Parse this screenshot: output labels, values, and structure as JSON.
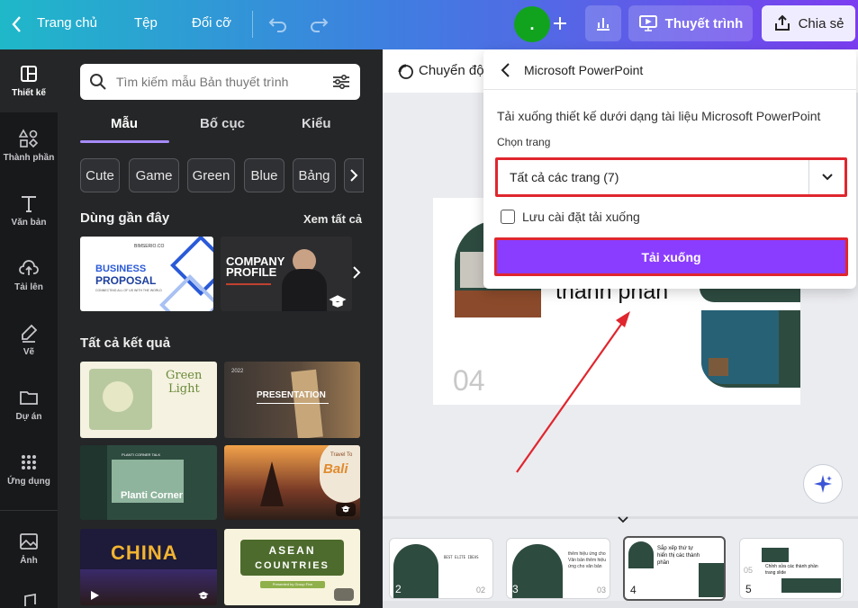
{
  "topbar": {
    "home_label": "Trang chủ",
    "file_label": "Tệp",
    "resize_label": "Đổi cỡ",
    "avatar_initial": ".",
    "present_label": "Thuyết trình",
    "share_label": "Chia sẻ"
  },
  "rail": {
    "items": [
      {
        "label": "Thiết kế",
        "icon": "layout-icon"
      },
      {
        "label": "Thành phần",
        "icon": "shapes-icon"
      },
      {
        "label": "Văn bản",
        "icon": "text-icon"
      },
      {
        "label": "Tải lên",
        "icon": "cloud-upload-icon"
      },
      {
        "label": "Vẽ",
        "icon": "pen-icon"
      },
      {
        "label": "Dự án",
        "icon": "folder-icon"
      },
      {
        "label": "Ứng dụng",
        "icon": "apps-grid-icon"
      },
      {
        "label": "Ảnh",
        "icon": "image-icon"
      }
    ]
  },
  "panel": {
    "search_placeholder": "Tìm kiếm mẫu Bản thuyết trình",
    "tabs": [
      "Mẫu",
      "Bố cục",
      "Kiểu"
    ],
    "chips": [
      "Cute",
      "Game",
      "Green",
      "Blue",
      "Bảng"
    ],
    "recent_heading": "Dùng gần đây",
    "see_all": "Xem tất cả",
    "recent": [
      {
        "title_line1": "BUSINESS",
        "title_line2": "PROPOSAL",
        "caption": "CONNECTING ALL OF US WITH THE WORLD",
        "brand": "BIMSERIO.CO"
      },
      {
        "title_line1": "COMPANY",
        "title_line2": "PROFILE"
      }
    ],
    "all_heading": "Tất cả kết quả",
    "results": [
      {
        "line1": "Green",
        "line2": "Light"
      },
      {
        "year": "2022",
        "title": "PRESENTATION"
      },
      {
        "title": "Planti Corner",
        "eyebrow": "PLANTI CORNER TALK"
      },
      {
        "script": "Travel To",
        "title": "Bali"
      },
      {
        "title": "CHINA"
      },
      {
        "line1": "ASEAN",
        "line2": "COUNTRIES",
        "sub": "Presented by Group Five"
      }
    ]
  },
  "canvas": {
    "toolbar_label": "Chuyển độ",
    "slide_title": "thành phần",
    "slide_number": "04"
  },
  "popup": {
    "title": "Microsoft PowerPoint",
    "description": "Tải xuống thiết kế dưới dạng tài liệu Microsoft PowerPoint",
    "select_label": "Chọn trang",
    "select_value": "Tất cả các trang (7)",
    "checkbox_label": "Lưu cài đặt tải xuống",
    "download_label": "Tải xuống"
  },
  "filmstrip": {
    "pages": [
      {
        "number": "2",
        "text": "BEST ELITE IDEAS",
        "corner": "02"
      },
      {
        "number": "3",
        "text": "thêm hiệu ứng cho Văn bản thêm hiệu ứng cho văn bản",
        "corner": "03"
      },
      {
        "number": "4",
        "text": "Sắp xếp thứ tự hiển thị các thành phần"
      },
      {
        "number": "5",
        "text": "Chỉnh sửa các thành phần trang slide",
        "corner": "05"
      }
    ]
  },
  "colors": {
    "accent_purple": "#8b3dff",
    "highlight_red": "#e0262e",
    "avatar_green": "#12a31e",
    "dark_green": "#2e4b40"
  }
}
